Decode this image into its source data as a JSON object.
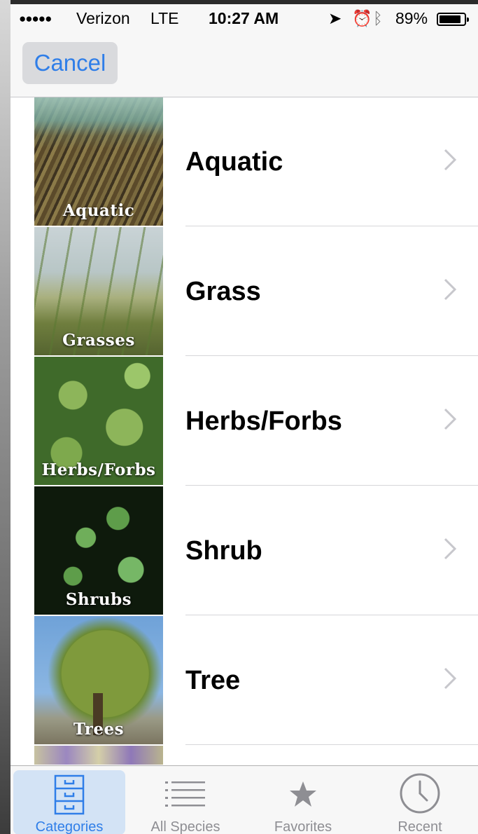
{
  "status_bar": {
    "signal": "●●●●●",
    "carrier": "Verizon",
    "network": "LTE",
    "time": "10:27 AM",
    "battery_percent": "89%",
    "battery_level": 0.89
  },
  "nav": {
    "cancel_label": "Cancel"
  },
  "categories": [
    {
      "label": "Aquatic",
      "caption": "Aquatic"
    },
    {
      "label": "Grass",
      "caption": "Grasses"
    },
    {
      "label": "Herbs/Forbs",
      "caption": "Herbs/Forbs"
    },
    {
      "label": "Shrub",
      "caption": "Shrubs"
    },
    {
      "label": "Tree",
      "caption": "Trees"
    }
  ],
  "tabs": [
    {
      "label": "Categories",
      "icon": "cabinet-icon",
      "active": true
    },
    {
      "label": "All Species",
      "icon": "list-icon",
      "active": false
    },
    {
      "label": "Favorites",
      "icon": "star-icon",
      "active": false
    },
    {
      "label": "Recent",
      "icon": "clock-icon",
      "active": false
    }
  ],
  "colors": {
    "accent": "#2f7ee8",
    "tab_active_bg": "#d3e3f5"
  }
}
